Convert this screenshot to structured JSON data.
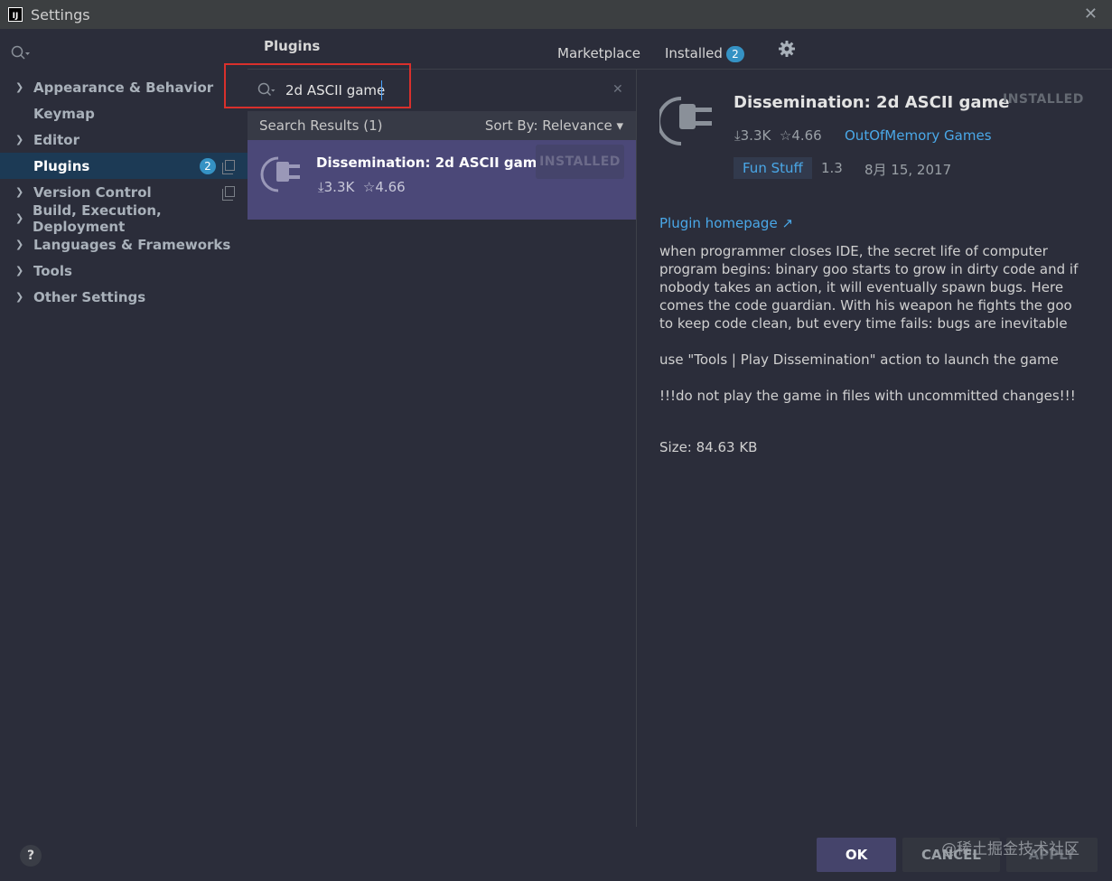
{
  "window": {
    "title": "Settings",
    "app_icon_text": "IJ",
    "close_glyph": "✕"
  },
  "sidebar": {
    "items": [
      {
        "label": "Appearance & Behavior",
        "chevron": "❯"
      },
      {
        "label": "Keymap",
        "chevron": ""
      },
      {
        "label": "Editor",
        "chevron": "❯"
      },
      {
        "label": "Plugins",
        "chevron": "",
        "badge": "2"
      },
      {
        "label": "Version Control",
        "chevron": "❯"
      },
      {
        "label": "Build, Execution, Deployment",
        "chevron": "❯"
      },
      {
        "label": "Languages & Frameworks",
        "chevron": "❯"
      },
      {
        "label": "Tools",
        "chevron": "❯"
      },
      {
        "label": "Other Settings",
        "chevron": "❯"
      }
    ]
  },
  "plugins": {
    "title": "Plugins",
    "tabs": {
      "marketplace": "Marketplace",
      "installed": "Installed",
      "installed_badge": "2"
    },
    "search": {
      "value": "2d ASCII game",
      "clear_glyph": "✕"
    },
    "results": {
      "count_label": "Search Results (1)",
      "sort_label": "Sort By: Relevance ▾",
      "items": [
        {
          "name": "Dissemination: 2d ASCII game",
          "downloads": "⤓3.3K",
          "rating": "☆4.66",
          "status": "INSTALLED"
        }
      ]
    }
  },
  "detail": {
    "name": "Dissemination: 2d ASCII game",
    "status": "INSTALLED",
    "downloads": "⤓3.3K",
    "rating": "☆4.66",
    "vendor": "OutOfMemory Games",
    "tag": "Fun Stuff",
    "version": "1.3",
    "date": "8月 15, 2017",
    "homepage": "Plugin homepage ↗",
    "description": [
      "when programmer closes IDE, the secret life of computer program begins: binary goo starts to grow in dirty code and if nobody takes an action, it will eventually spawn bugs. Here comes the code guardian. With his weapon he fights the goo to keep code clean, but every time fails: bugs are inevitable",
      "use \"Tools | Play Dissemination\" action to launch the game",
      "!!!do not play the game in files with uncommitted changes!!!"
    ],
    "size": "Size: 84.63 KB"
  },
  "footer": {
    "help": "?",
    "ok": "OK",
    "cancel": "CANCEL",
    "apply": "APPLY",
    "watermark": "@稀土掘金技术社区"
  },
  "colors": {
    "accent": "#3592c4",
    "selection": "#4b4878",
    "link": "#4aa8e8",
    "highlight_box": "#d9302c"
  }
}
